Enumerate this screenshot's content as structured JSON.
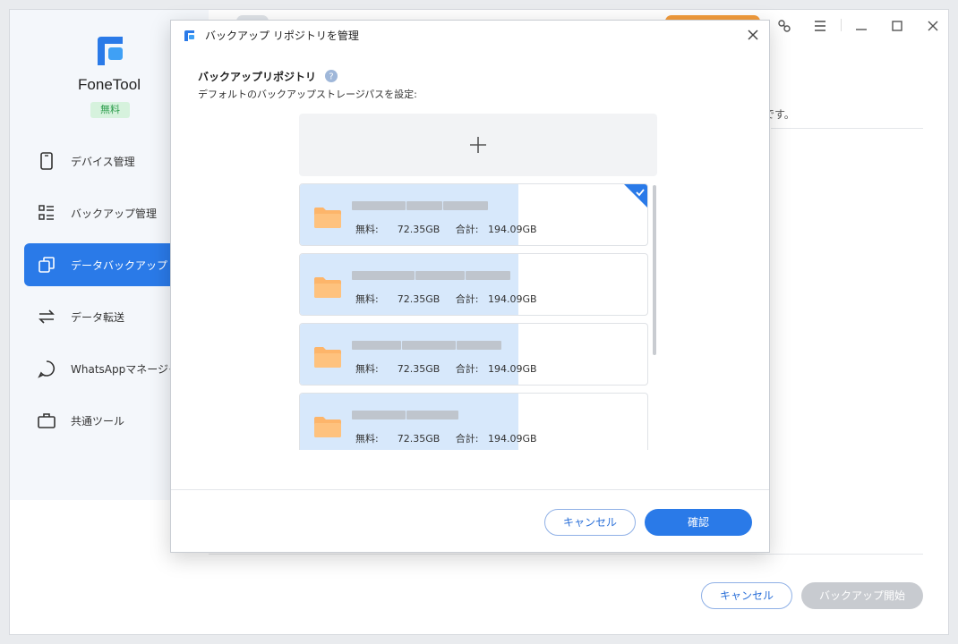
{
  "app": {
    "name": "FoneTool",
    "badge": "無料"
  },
  "sidebar": {
    "items": [
      {
        "label": "デバイス管理",
        "icon": "phone-icon",
        "active": false
      },
      {
        "label": "バックアップ管理",
        "icon": "list-grid-icon",
        "active": false
      },
      {
        "label": "データバックアップ",
        "icon": "copy-icon",
        "active": true
      },
      {
        "label": "データ転送",
        "icon": "transfer-arrows-icon",
        "active": false
      },
      {
        "label": "WhatsAppマネージャ",
        "icon": "chat-bubble-icon",
        "active": false
      },
      {
        "label": "共通ツール",
        "icon": "toolbox-icon",
        "active": false
      }
    ]
  },
  "background": {
    "text_fragment": "です。",
    "cancel_label": "キャンセル",
    "start_label": "バックアップ開始"
  },
  "dialog": {
    "title": "バックアップ リポジトリを管理",
    "section_title": "バックアップリポジトリ",
    "section_subtitle": "デフォルトのバックアップストレージパスを設定:",
    "repositories": [
      {
        "free_label": "無料:",
        "free_value": "72.35GB",
        "total_label": "合計:",
        "total_value": "194.09GB",
        "selected": true
      },
      {
        "free_label": "無料:",
        "free_value": "72.35GB",
        "total_label": "合計:",
        "total_value": "194.09GB",
        "selected": false
      },
      {
        "free_label": "無料:",
        "free_value": "72.35GB",
        "total_label": "合計:",
        "total_value": "194.09GB",
        "selected": false
      },
      {
        "free_label": "無料:",
        "free_value": "72.35GB",
        "total_label": "合計:",
        "total_value": "194.09GB",
        "selected": false
      }
    ],
    "cancel_label": "キャンセル",
    "ok_label": "確認"
  },
  "colors": {
    "accent": "#2a7ae8",
    "folder": "#fdb56a",
    "selected_fill": "#d7e8fb"
  }
}
